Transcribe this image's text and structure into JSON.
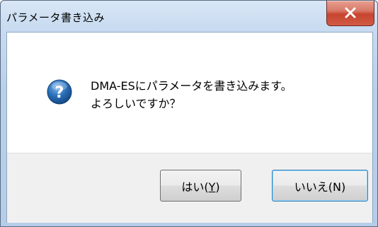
{
  "window": {
    "title": "パラメータ書き込み",
    "close_glyph": "X"
  },
  "message": {
    "line1": "DMA-ESにパラメータを書き込みます。",
    "line2": "よろしいですか？"
  },
  "icon": {
    "name": "question-icon",
    "glyph": "?",
    "color": "#2a6fb8"
  },
  "buttons": {
    "yes": {
      "prefix": "はい(",
      "accel": "Y",
      "suffix": ")"
    },
    "no": {
      "label": "いいえ(N)"
    }
  },
  "colors": {
    "close_button": "#c7442f",
    "default_button_border": "#3c7fb1"
  }
}
